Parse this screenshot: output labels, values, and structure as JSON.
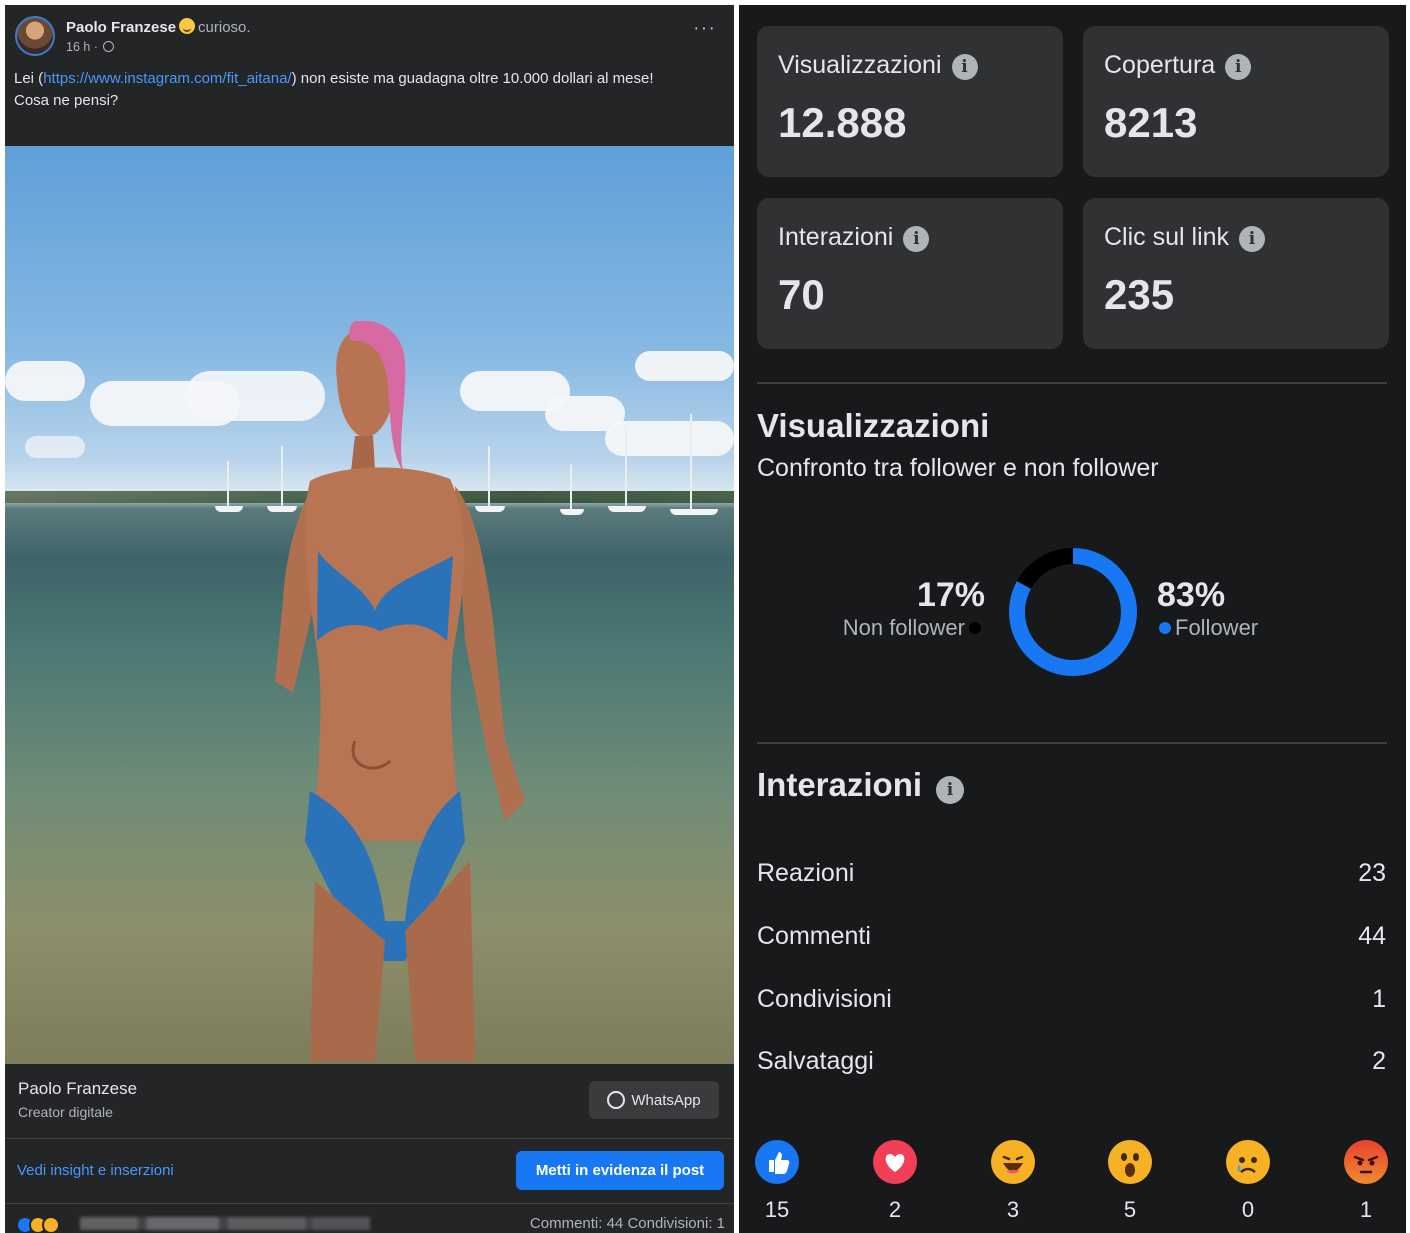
{
  "post": {
    "author": "Paolo Franzese",
    "feeling": "curioso.",
    "time": "16 h ·",
    "text_prefix": "Lei (",
    "link": "https://www.instagram.com/fit_aitana/",
    "text_suffix": ") non esiste ma guadagna oltre 10.000 dollari al mese!",
    "text_line2": "Cosa ne pensi?",
    "page_name": "Paolo Franzese",
    "page_role": "Creator digitale",
    "whatsapp_label": "WhatsApp",
    "insights_link": "Vedi insight e inserzioni",
    "boost_label": "Metti in evidenza il post",
    "counts": "Commenti: 44   Condivisioni: 1",
    "icons": {
      "more": "more-icon",
      "globe": "globe-icon",
      "whatsapp": "whatsapp-icon"
    }
  },
  "cards": [
    {
      "label": "Visualizzazioni",
      "value": "12.888"
    },
    {
      "label": "Copertura",
      "value": "8213"
    },
    {
      "label": "Interazioni",
      "value": "70"
    },
    {
      "label": "Clic sul link",
      "value": "235"
    }
  ],
  "views_section": {
    "title": "Visualizzazioni",
    "subtitle": "Confronto tra follower e non follower",
    "non_follower_pct": "17%",
    "non_follower_label": "Non follower",
    "follower_pct": "83%",
    "follower_label": "Follower"
  },
  "chart_data": {
    "type": "pie",
    "categories": [
      "Non follower",
      "Follower"
    ],
    "values": [
      17,
      83
    ],
    "colors": {
      "Follower": "#1877f2",
      "Non follower": "#000000"
    }
  },
  "interactions_section": {
    "title": "Interazioni",
    "rows": [
      {
        "label": "Reazioni",
        "value": "23"
      },
      {
        "label": "Commenti",
        "value": "44"
      },
      {
        "label": "Condivisioni",
        "value": "1"
      },
      {
        "label": "Salvataggi",
        "value": "2"
      }
    ]
  },
  "reactions": [
    {
      "icon": "like-icon",
      "count": "15",
      "color": "#1877f2"
    },
    {
      "icon": "love-icon",
      "count": "2",
      "color": "#f33e58"
    },
    {
      "icon": "haha-icon",
      "count": "3",
      "color": "#f7b125"
    },
    {
      "icon": "wow-icon",
      "count": "5",
      "color": "#f7b125"
    },
    {
      "icon": "sad-icon",
      "count": "0",
      "color": "#f7b125"
    },
    {
      "icon": "angry-icon",
      "count": "1",
      "color": "#e9710f"
    }
  ]
}
